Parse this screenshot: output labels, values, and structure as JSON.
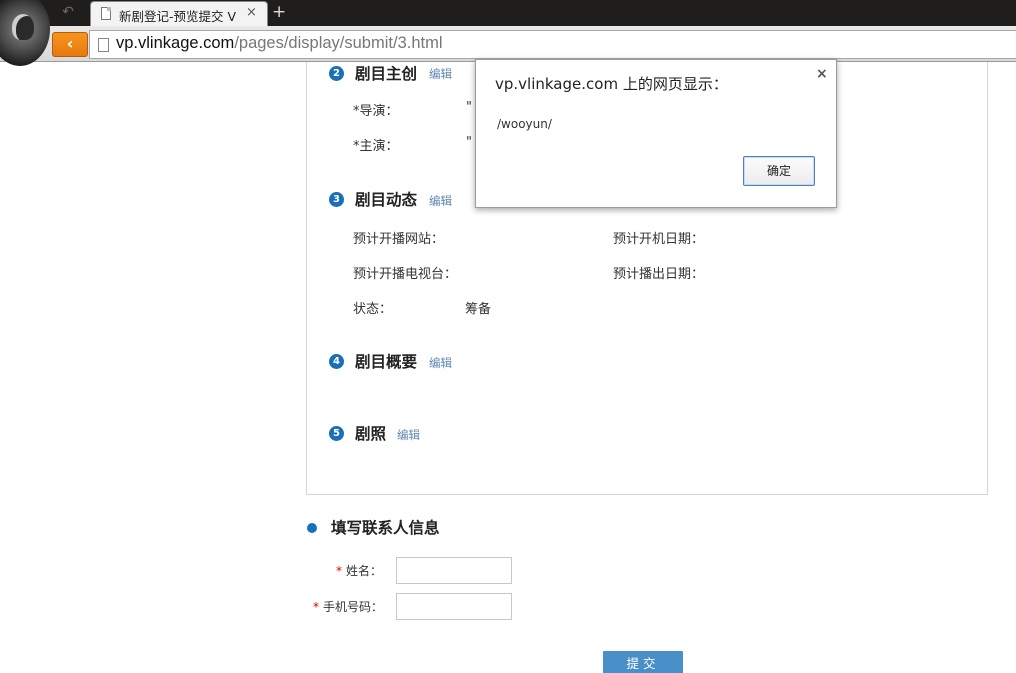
{
  "browser": {
    "tab_title": "新剧登记-预览提交 V",
    "tab_close": "×",
    "new_tab": "+",
    "back_mini": "↶",
    "back_arrow": "‹",
    "url_host": "vp.vlinkage.com",
    "url_path": "/pages/display/submit/3.html"
  },
  "sections": [
    {
      "num": "2",
      "title": "剧目主创",
      "edit": "编辑"
    },
    {
      "num": "3",
      "title": "剧目动态",
      "edit": "编辑"
    },
    {
      "num": "4",
      "title": "剧目概要",
      "edit": "编辑"
    },
    {
      "num": "5",
      "title": "剧照",
      "edit": "编辑"
    }
  ],
  "creators": {
    "director_label": "*导演：",
    "director_value": "\"",
    "lead_label": "*主演：",
    "lead_value": "\""
  },
  "dynamics": {
    "website_label": "预计开播网站：",
    "start_date_label": "预计开机日期：",
    "tv_label": "预计开播电视台：",
    "air_date_label": "预计播出日期：",
    "status_label": "状态：",
    "status_value": "筹备"
  },
  "contact": {
    "title": "填写联系人信息",
    "name_label": "姓名：",
    "phone_label": "手机号码：",
    "required_mark": "*",
    "name_value": "",
    "phone_value": "",
    "submit_label": "提交"
  },
  "alert": {
    "title": "vp.vlinkage.com 上的网页显示：",
    "message": "/wooyun/",
    "ok_label": "确定",
    "close": "×"
  },
  "colors": {
    "accent": "#1a6fb8",
    "link": "#5b86b0",
    "submit": "#4a90c8",
    "back_button": "#f7941d",
    "required": "#dd0000"
  }
}
